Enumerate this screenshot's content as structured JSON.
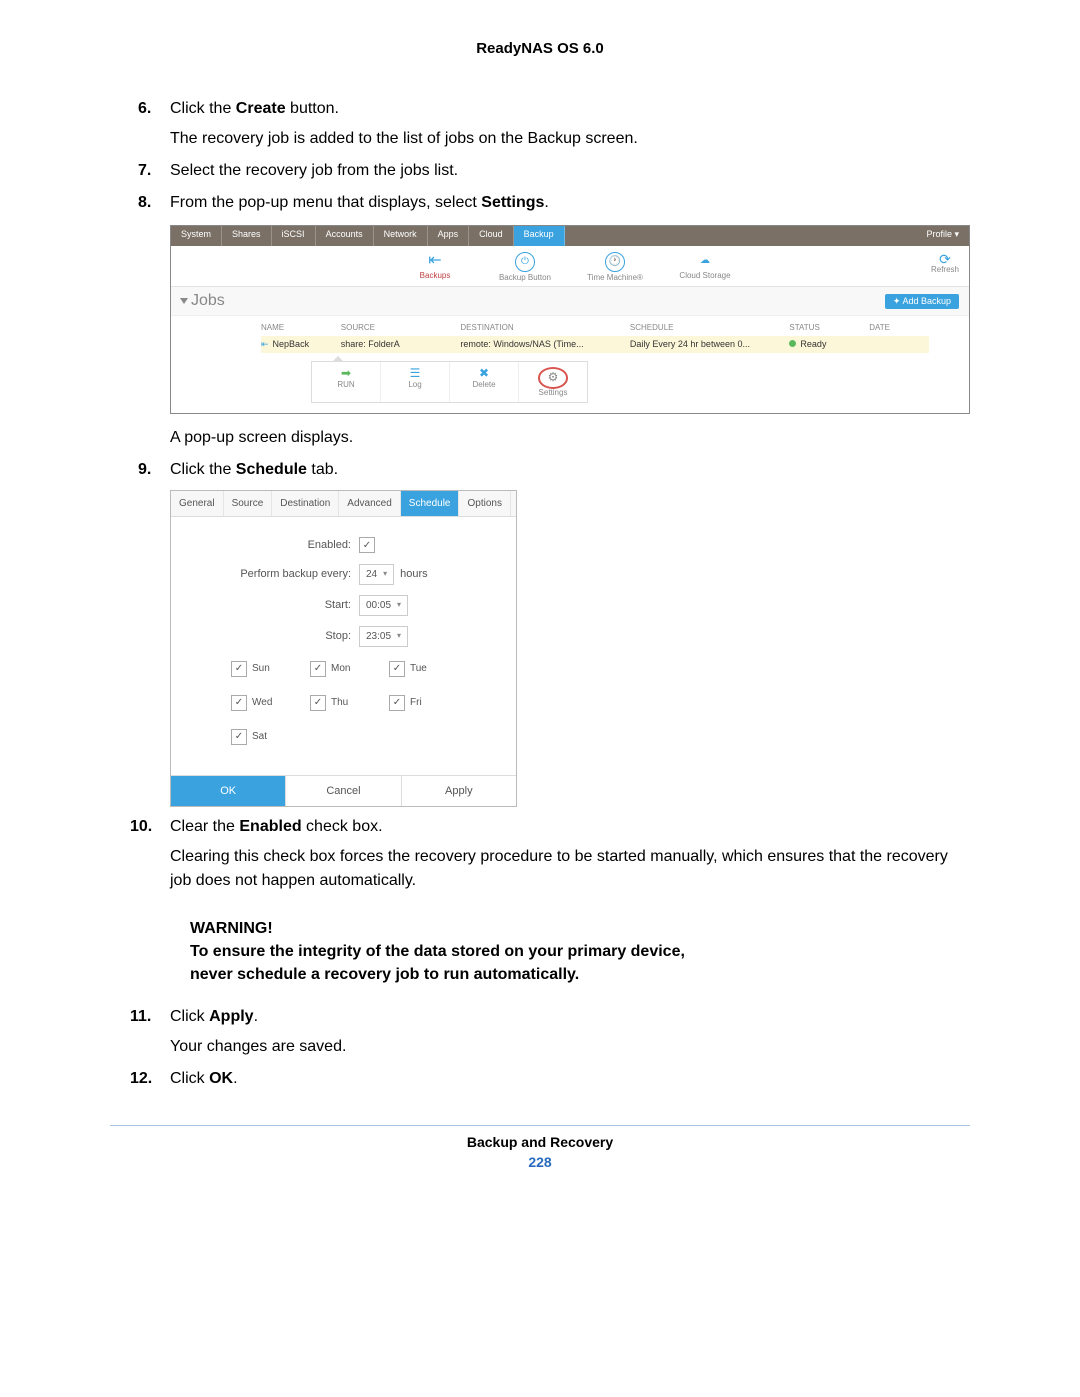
{
  "header": {
    "product": "ReadyNAS OS 6.0"
  },
  "steps": {
    "s6_a": "Click the ",
    "s6_bold": "Create",
    "s6_b": " button.",
    "s6_sub": "The recovery job is added to the list of jobs on the Backup screen.",
    "s7": "Select the recovery job from the jobs list.",
    "s8_a": "From the pop-up menu that displays, select ",
    "s8_bold": "Settings",
    "s8_b": ".",
    "s8_after": "A pop-up screen displays.",
    "s9_a": "Click the ",
    "s9_bold": "Schedule",
    "s9_b": " tab.",
    "s10_a": "Clear the ",
    "s10_bold": "Enabled",
    "s10_b": " check box.",
    "s10_sub": "Clearing this check box forces the recovery procedure to be started manually, which ensures that the recovery job does not happen automatically.",
    "s11_a": "Click ",
    "s11_bold": "Apply",
    "s11_b": ".",
    "s11_sub": "Your changes are saved.",
    "s12_a": "Click ",
    "s12_bold": "OK",
    "s12_b": "."
  },
  "shot1": {
    "tabs": [
      "System",
      "Shares",
      "iSCSI",
      "Accounts",
      "Network",
      "Apps",
      "Cloud",
      "Backup"
    ],
    "profile": "Profile ▾",
    "subnav": {
      "backups": "Backups",
      "backup_button": "Backup Button",
      "time_machine": "Time Machine®",
      "cloud_storage": "Cloud Storage",
      "refresh": "Refresh"
    },
    "jobs_label": "Jobs",
    "add_backup": "✦ Add Backup",
    "columns": {
      "name": "NAME",
      "source": "SOURCE",
      "destination": "DESTINATION",
      "schedule": "SCHEDULE",
      "status": "STATUS",
      "date": "DATE"
    },
    "row": {
      "name": "NepBack",
      "source": "share: FolderA",
      "destination": "remote: Windows/NAS (Time...",
      "schedule": "Daily Every 24 hr between 0...",
      "status": "Ready"
    },
    "actions": {
      "run": "RUN",
      "log": "Log",
      "delete": "Delete",
      "settings": "Settings"
    }
  },
  "shot2": {
    "tabs": [
      "General",
      "Source",
      "Destination",
      "Advanced",
      "Schedule",
      "Options"
    ],
    "enabled_label": "Enabled:",
    "every_label": "Perform backup every:",
    "every_value": "24",
    "every_unit": "hours",
    "start_label": "Start:",
    "start_value": "00:05",
    "stop_label": "Stop:",
    "stop_value": "23:05",
    "days": [
      "Sun",
      "Mon",
      "Tue",
      "Wed",
      "Thu",
      "Fri",
      "Sat"
    ],
    "ok": "OK",
    "cancel": "Cancel",
    "apply": "Apply"
  },
  "warning": {
    "title": "WARNING!",
    "line1": "To ensure the integrity of the data stored on your primary device,",
    "line2": "never schedule a recovery job to run automatically."
  },
  "footer": {
    "section": "Backup and Recovery",
    "page": "228"
  }
}
